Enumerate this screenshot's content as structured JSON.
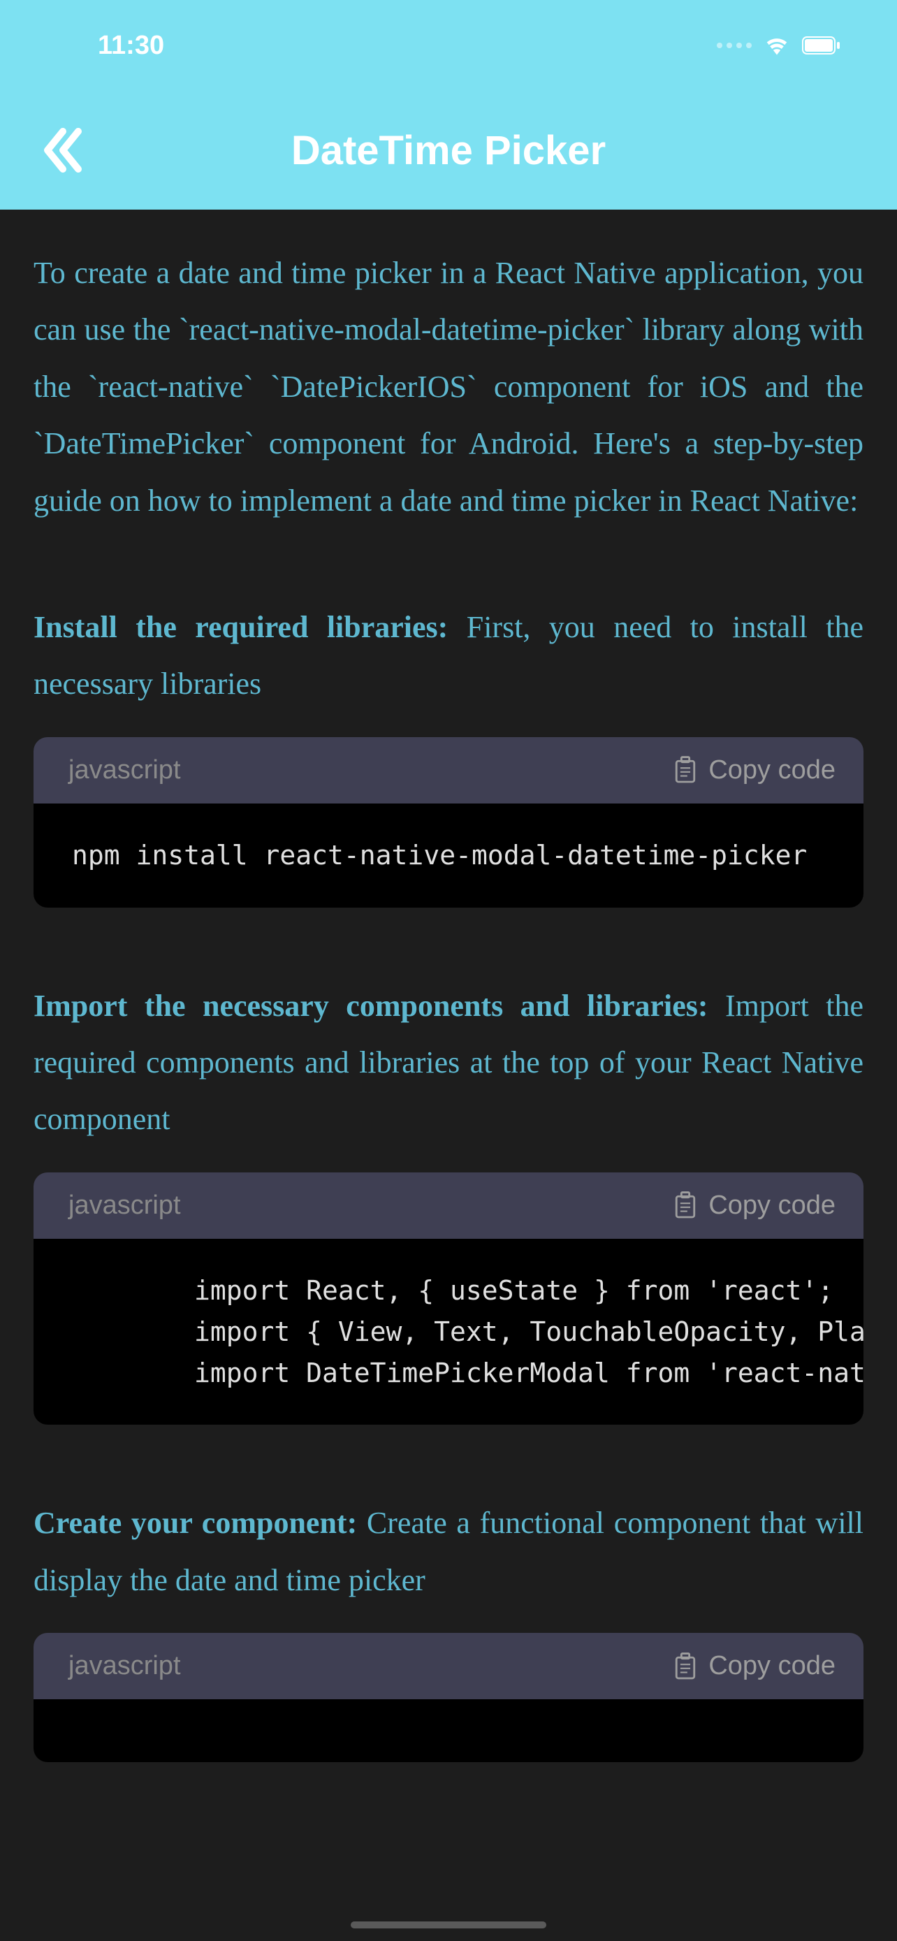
{
  "status": {
    "time": "11:30"
  },
  "nav": {
    "title": "DateTime Picker"
  },
  "intro": "To create a date and time picker in a React Native application, you can use the `react-native-modal-datetime-picker` library along with the `react-native` `DatePickerIOS` component for iOS and the `DateTimePicker` component for Android. Here's a step-by-step guide on how to implement a date and time picker in React Native:",
  "sections": [
    {
      "title": "Install the required libraries:",
      "desc": " First, you need to install the necessary libraries",
      "lang": "javascript",
      "copy_label": "Copy code",
      "code": "npm install react-native-modal-datetime-picker"
    },
    {
      "title": "Import the necessary components and libraries:",
      "desc": " Import the required components and libraries at the top of your React Native component",
      "lang": "javascript",
      "copy_label": "Copy code",
      "code": "import React, { useState } from 'react';\nimport { View, Text, TouchableOpacity, Platform\nimport DateTimePickerModal from 'react-native"
    },
    {
      "title": "Create your component:",
      "desc": "  Create a functional component that will display the date and time picker",
      "lang": "javascript",
      "copy_label": "Copy code",
      "code": ""
    }
  ]
}
